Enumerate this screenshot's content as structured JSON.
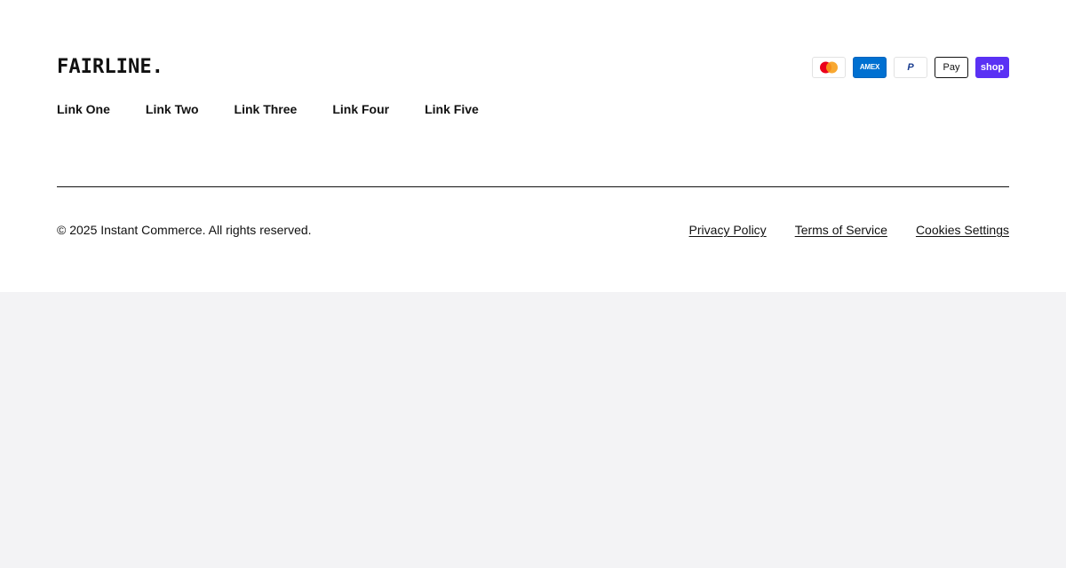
{
  "brand": {
    "logo_text": "FAIRLINE."
  },
  "payments": [
    {
      "icon": "mastercard-icon",
      "label": ""
    },
    {
      "icon": "amex-icon",
      "label": "AMEX"
    },
    {
      "icon": "paypal-icon",
      "label": "P"
    },
    {
      "icon": "apple-pay-icon",
      "label": " Pay"
    },
    {
      "icon": "shop-pay-icon",
      "label": "shop"
    }
  ],
  "nav": {
    "links": [
      "Link One",
      "Link Two",
      "Link Three",
      "Link Four",
      "Link Five"
    ]
  },
  "bottom": {
    "copyright": "© 2025 Instant Commerce. All rights reserved.",
    "links": [
      "Privacy Policy",
      "Terms of Service",
      "Cookies Settings"
    ]
  },
  "colors": {
    "page_background": "#f3f3f5",
    "footer_background": "#ffffff",
    "text": "#111111",
    "amex_blue": "#0070d1",
    "shop_purple": "#5a31f4"
  }
}
